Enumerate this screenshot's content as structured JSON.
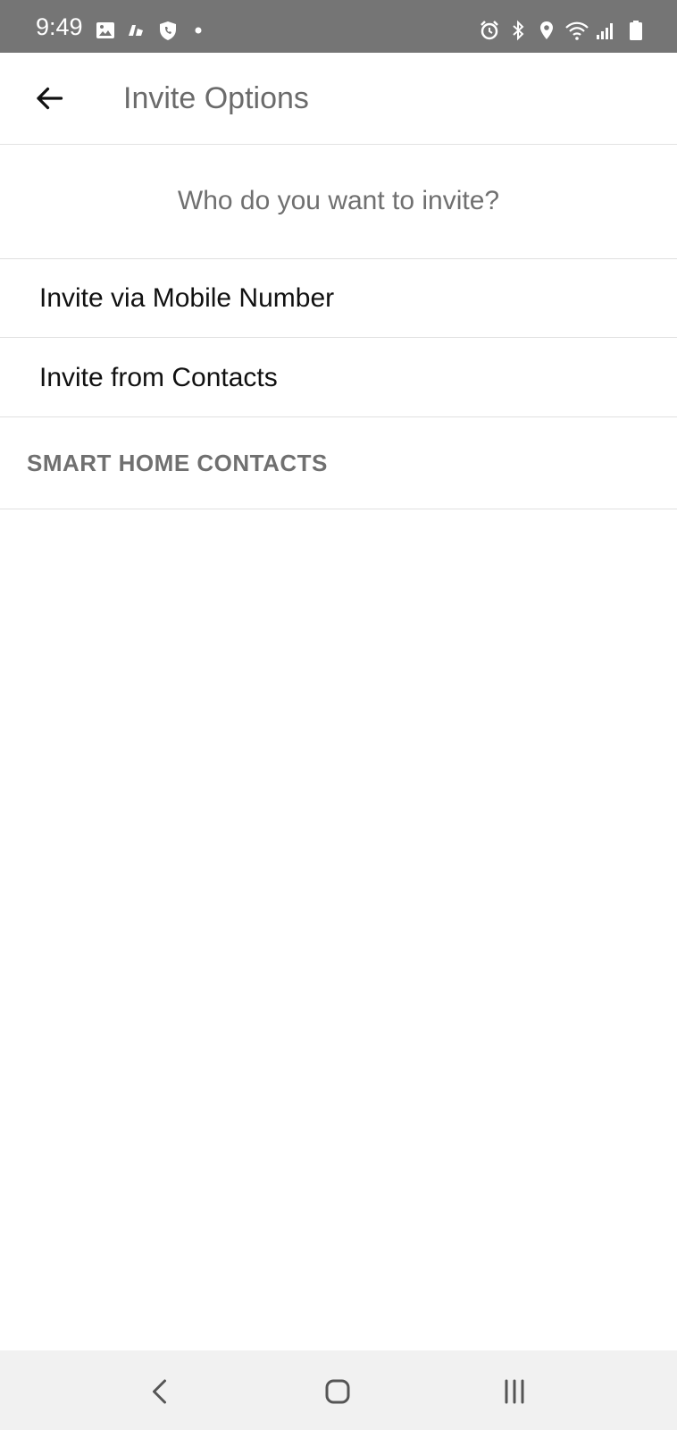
{
  "status_bar": {
    "time": "9:49",
    "left_icons": [
      "gallery-icon",
      "cloud-icon",
      "shield-phone-icon",
      "dot-icon"
    ],
    "right_icons": [
      "alarm-icon",
      "bluetooth-icon",
      "location-icon",
      "wifi-icon",
      "signal-icon",
      "battery-icon"
    ],
    "background": "#757575"
  },
  "app_bar": {
    "title": "Invite Options",
    "back_icon": "back-arrow-icon"
  },
  "content": {
    "question": "Who do you want to invite?",
    "options": [
      {
        "label": "Invite via Mobile Number"
      },
      {
        "label": "Invite from Contacts"
      }
    ],
    "section_header": "SMART HOME CONTACTS"
  },
  "nav_bar": {
    "icons": [
      "nav-back-icon",
      "nav-home-icon",
      "nav-recents-icon"
    ],
    "background": "#f1f1f1"
  }
}
